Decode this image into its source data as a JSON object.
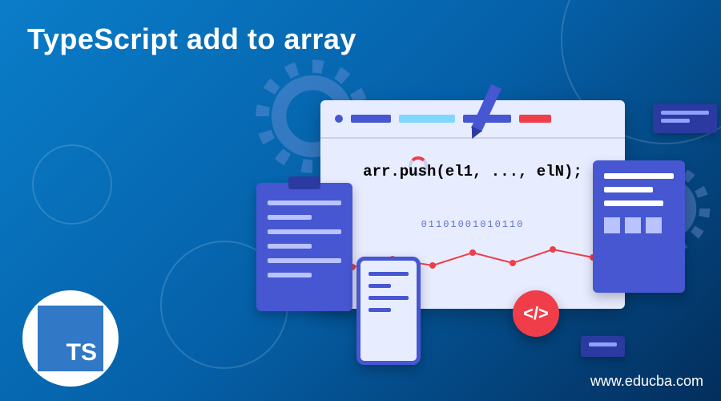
{
  "title": "TypeScript add to array",
  "website": "www.educba.com",
  "logo_text": "TS",
  "code_snippet": "arr.push(el1, ..., elN);",
  "binary_string": "01101001010110",
  "code_badge": "</>",
  "colors": {
    "accent_blue": "#4657d1",
    "accent_red": "#ef3e4a",
    "accent_cyan": "#7fd6ff",
    "panel_light": "#e8ecff"
  },
  "topbar": {
    "dot1": "#4657d1",
    "bar1": "#4657d1",
    "bar2": "#7fd6ff",
    "bar3": "#4657d1",
    "bar4": "#ef3e4a"
  }
}
